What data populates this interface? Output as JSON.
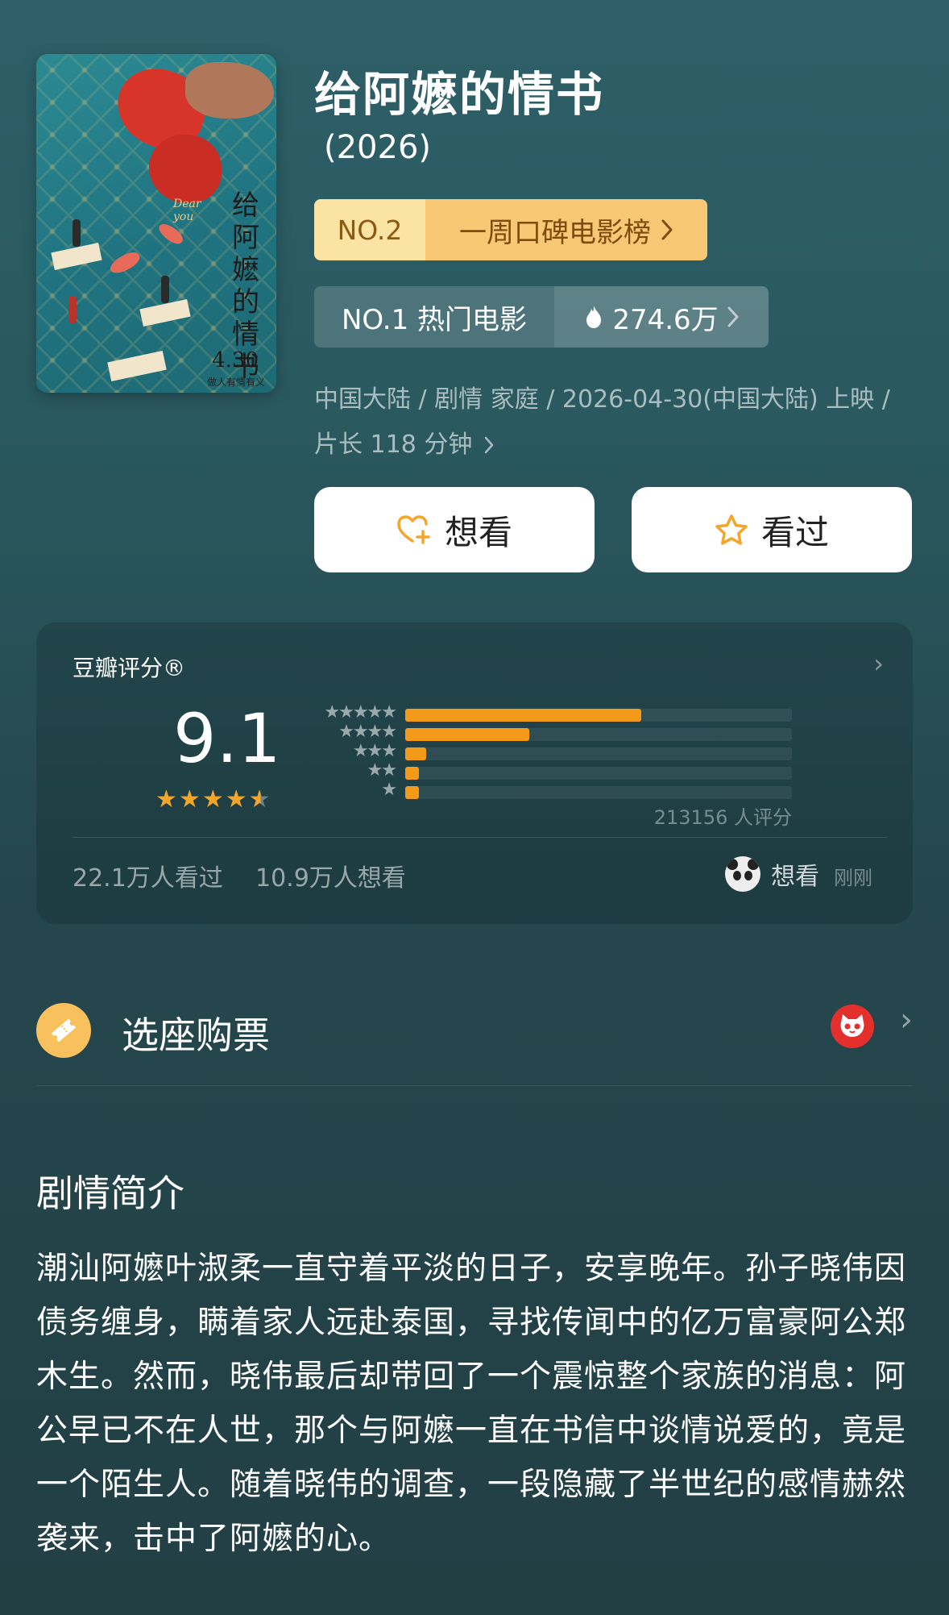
{
  "poster": {
    "vertical_title": "给阿嬷的情书",
    "date": "4.30",
    "tagline": "做人有情有义",
    "english": "Dear you"
  },
  "movie": {
    "title": "给阿嬷的情书",
    "year": "(2026)"
  },
  "ranks": {
    "weekly": {
      "no": "NO.2",
      "label": "一周口碑电影榜"
    },
    "hot": {
      "no": "NO.1 热门电影",
      "heat": "274.6万"
    }
  },
  "meta_text": "中国大陆 / 剧情 家庭 / 2026-04-30(中国大陆) 上映 / 片长 118 分钟",
  "buttons": {
    "want": "想看",
    "seen": "看过"
  },
  "rating": {
    "header": "豆瓣评分®",
    "score": "9.1",
    "star_level": 4.5,
    "count_text": "213156 人评分",
    "distribution": [
      {
        "stars": "★★★★★",
        "fraction": 0.61
      },
      {
        "stars": "★★★★",
        "fraction": 0.32
      },
      {
        "stars": "★★★",
        "fraction": 0.055
      },
      {
        "stars": "★★",
        "fraction": 0.035
      },
      {
        "stars": "★",
        "fraction": 0.035
      }
    ],
    "watched": "22.1万人看过",
    "wanted": "10.9万人想看",
    "activity": "想看",
    "activity_time": "刚刚"
  },
  "ticket": {
    "label": "选座购票"
  },
  "synopsis": {
    "title": "剧情简介",
    "body": "潮汕阿嬷叶淑柔一直守着平淡的日子，安享晚年。孙子晓伟因债务缠身，瞒着家人远赴泰国，寻找传闻中的亿万富豪阿公郑木生。然而，晓伟最后却带回了一个震惊整个家族的消息：阿公早已不在人世，那个与阿嬷一直在书信中谈情说爱的，竟是一个陌生人。随着晓伟的调查，一段隐藏了半世纪的感情赫然袭来，击中了阿嬷的心。"
  },
  "colors": {
    "accent_orange": "#f49a1a",
    "rank_gold": "#f8c874",
    "star": "#f4a62a"
  }
}
